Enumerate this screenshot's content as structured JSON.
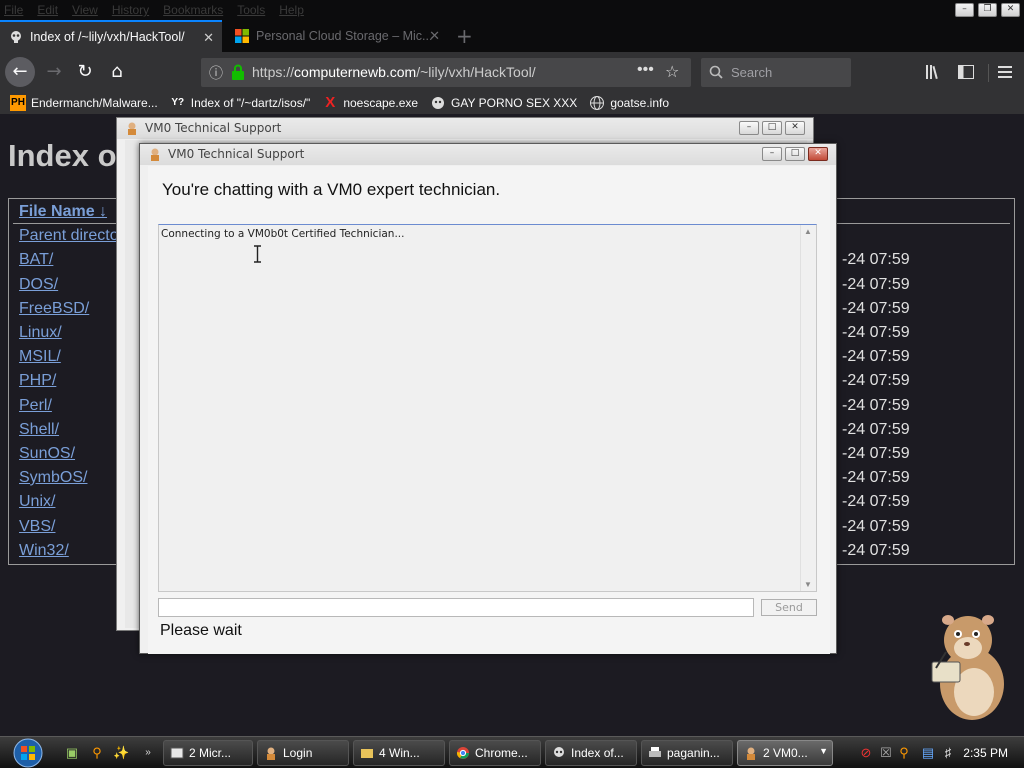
{
  "browser": {
    "menu": [
      "File",
      "Edit",
      "View",
      "History",
      "Bookmarks",
      "Tools",
      "Help"
    ],
    "tabs": [
      {
        "title": "Index of /~lily/vxh/HackTool/"
      },
      {
        "title": "Personal Cloud Storage – Mic..."
      }
    ],
    "url": {
      "scheme": "https://",
      "host": "computernewb.com",
      "path": "/~lily/vxh/HackTool/"
    },
    "search_placeholder": "Search",
    "bookmarks": [
      {
        "label": "Endermanch/Malware...",
        "icon": "PH"
      },
      {
        "label": "Index of \"/~dartz/isos/\"",
        "icon": "Y?"
      },
      {
        "label": "noescape.exe",
        "icon": "X"
      },
      {
        "label": "GAY PORNO SEX XXX",
        "icon": "mask-icon"
      },
      {
        "label": "goatse.info",
        "icon": "globe-icon"
      }
    ]
  },
  "page": {
    "heading": "Index o",
    "column_header": "File Name  ↓",
    "files": [
      "Parent directo",
      "BAT/",
      "DOS/",
      "FreeBSD/",
      "Linux/",
      "MSIL/",
      "PHP/",
      "Perl/",
      "Shell/",
      "SunOS/",
      "SymbOS/",
      "Unix/",
      "VBS/",
      "Win32/"
    ],
    "dates": [
      "-24 07:59",
      "-24 07:59",
      "-24 07:59",
      "-24 07:59",
      "-24 07:59",
      "-24 07:59",
      "-24 07:59",
      "-24 07:59",
      "-24 07:59",
      "-24 07:59",
      "-24 07:59",
      "-24 07:59",
      "-24 07:59"
    ]
  },
  "back_dialog": {
    "title": "VM0 Technical Support"
  },
  "dialog": {
    "title": "VM0 Technical Support",
    "heading": "You're chatting with a VM0 expert technician.",
    "log_message": "Connecting to a VM0b0t Certified Technician...",
    "input_value": "",
    "send_label": "Send",
    "status": "Please wait"
  },
  "taskbar": {
    "buttons": [
      {
        "label": "2 Micr...",
        "active": false
      },
      {
        "label": "Login",
        "active": false
      },
      {
        "label": "4 Win...",
        "active": false
      },
      {
        "label": "Chrome...",
        "active": false
      },
      {
        "label": "Index of...",
        "active": false
      },
      {
        "label": "paganin...",
        "active": false
      },
      {
        "label": "2 VM0...",
        "active": true
      }
    ],
    "clock": "2:35 PM"
  },
  "colors": {
    "accent": "#0a84ff",
    "link": "#7a9fd8",
    "page_bg": "#1c1b22"
  }
}
